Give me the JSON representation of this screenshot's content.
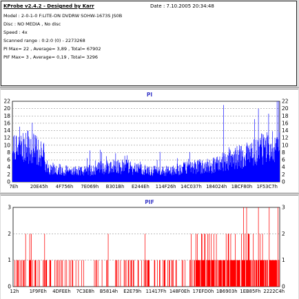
{
  "header": {
    "title": "KProbe v2.4.2 - Designed by Karr",
    "date": "Date : 7.10.2005 20:34:48",
    "model": "Model : 2-0-1-0 F:LITE-ON DVDRW SOHW-1673S JS0B",
    "disc": "Disc : NO MEDIA , No disc",
    "speed": "Speed : 4x",
    "scanned": "Scanned range : 0:2:0 (0) - 2273268",
    "pi_stats": "PI Max= 22 , Average= 3,89 , Total= 67902",
    "pif_stats": "PIF Max= 3 , Average= 0,19 , Total= 3296"
  },
  "chart_data": [
    {
      "type": "bar",
      "title": "PI",
      "xlabel": "",
      "ylabel": "",
      "ylim": [
        0,
        22
      ],
      "y_ticks": [
        "22",
        "20",
        "18",
        "16",
        "14",
        "12",
        "10",
        "8",
        "6",
        "4",
        "2",
        "0"
      ],
      "x_ticks": [
        "7Eh",
        "20E45h",
        "4F756h",
        "7E069h",
        "B301Bh",
        "E244Eh",
        "114F26h",
        "14C037h",
        "184024h",
        "1BCF80h",
        "1F53C7h"
      ],
      "color": "#0000ff",
      "max": 22,
      "average": 3.89
    },
    {
      "type": "bar",
      "title": "PIF",
      "xlabel": "",
      "ylabel": "",
      "ylim": [
        0,
        3
      ],
      "y_ticks": [
        "3",
        "2",
        "1",
        "0"
      ],
      "x_ticks": [
        "12h",
        "1F9FEh",
        "4DFEEh",
        "7C3E8h",
        "B5814h",
        "E2E79h",
        "11417Fh",
        "148F0Eh",
        "17EFD0h",
        "1B6903h",
        "1EB85Fh",
        "2222C4h"
      ],
      "color": "#ff0000",
      "max": 3,
      "average": 0.19
    }
  ]
}
